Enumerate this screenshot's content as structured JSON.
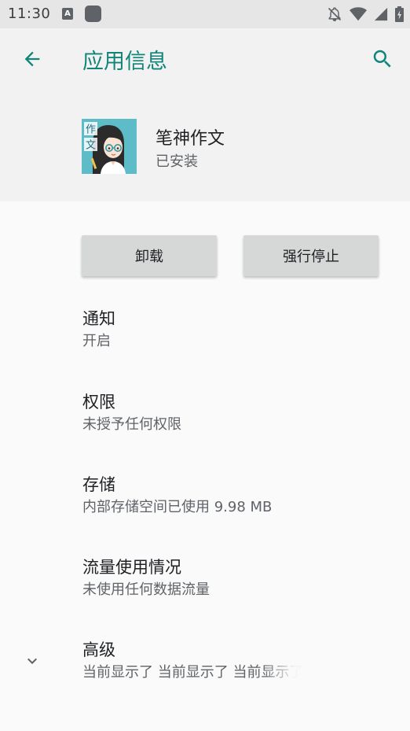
{
  "status_bar": {
    "time": "11:30",
    "notification_a_label": "A",
    "icons": [
      "notifications-off-icon",
      "wifi-icon",
      "signal-icon",
      "battery-icon"
    ]
  },
  "app_bar": {
    "title": "应用信息",
    "back_icon": "arrow-back-icon",
    "search_icon": "search-icon"
  },
  "app": {
    "name": "笔神作文",
    "status": "已安装",
    "icon_text": [
      "作",
      "文"
    ]
  },
  "buttons": {
    "uninstall": "卸载",
    "force_stop": "强行停止"
  },
  "preferences": [
    {
      "title": "通知",
      "summary": "开启"
    },
    {
      "title": "权限",
      "summary": "未授予任何权限"
    },
    {
      "title": "存储",
      "summary": "内部存储空间已使用 9.98 MB"
    },
    {
      "title": "流量使用情况",
      "summary": "未使用任何数据流量"
    },
    {
      "title": "高级",
      "summary": "当前显示了 当前显示了 当前显示了"
    }
  ],
  "colors": {
    "accent": "#128579",
    "appbar_bg": "#f2f2f2",
    "status_bar_bg": "#e6e6e6",
    "button_bg": "#d6d7d7"
  }
}
